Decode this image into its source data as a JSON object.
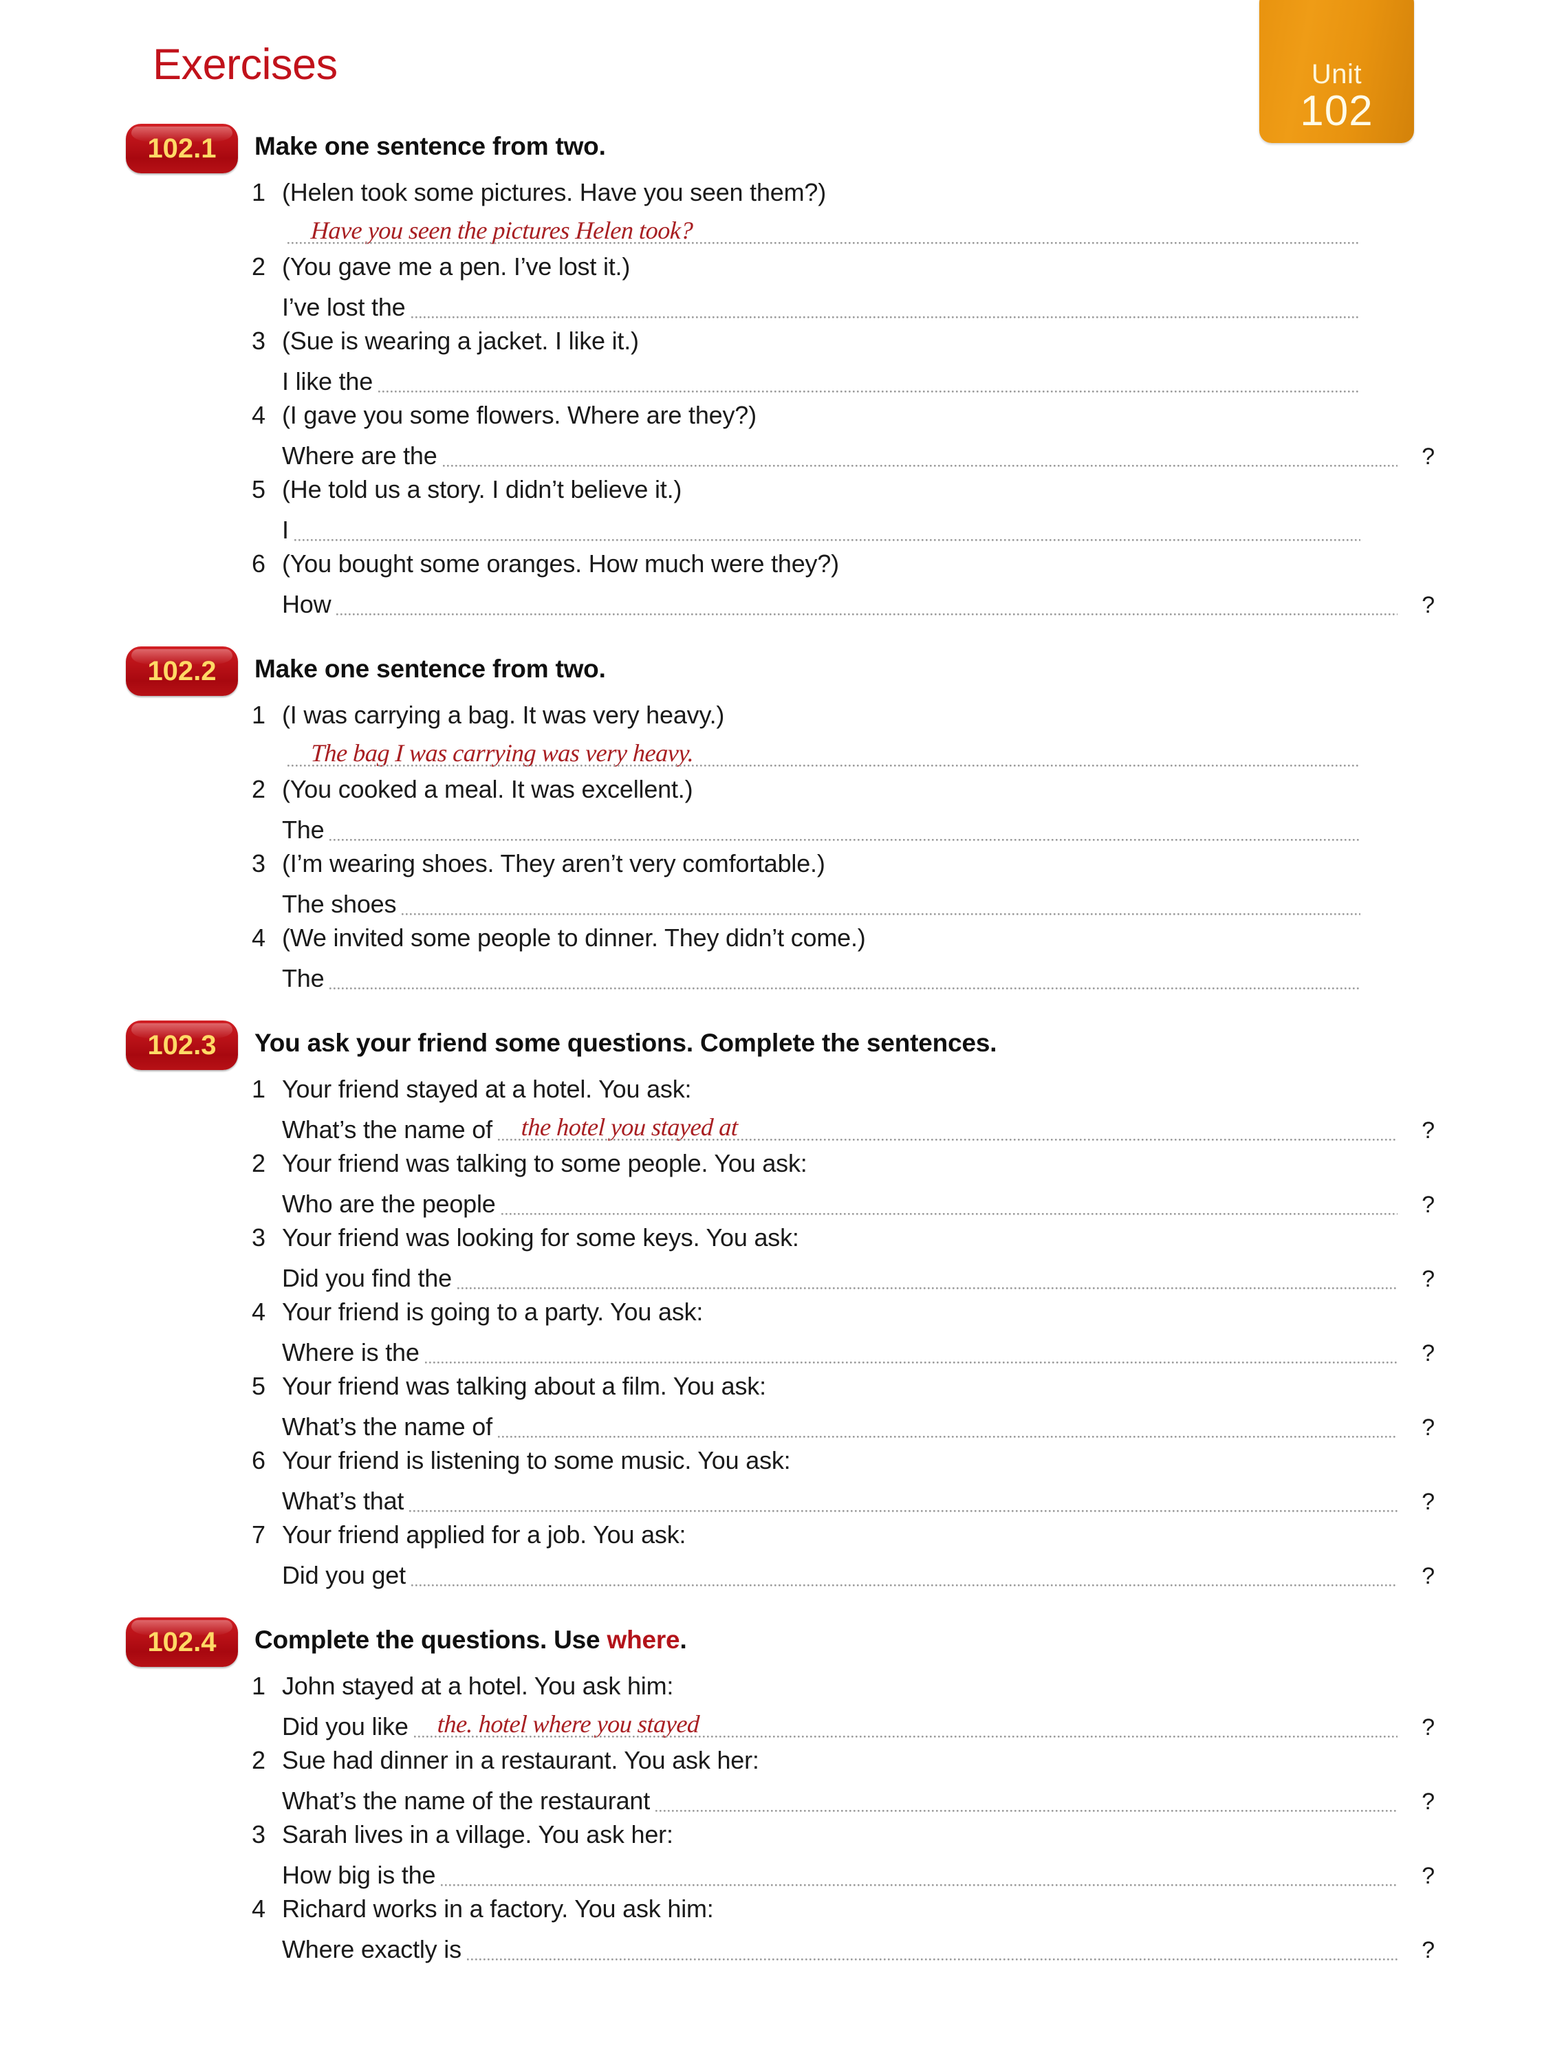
{
  "page": {
    "title": "Exercises",
    "title_color": "#c1121b",
    "unit_label": "Unit",
    "unit_number": "102",
    "badge_color": "#e8930f",
    "exercise_badge_color": "#c2161c",
    "handwriting_color": "#a81f22"
  },
  "exercises": [
    {
      "badge": "102.1",
      "title_pre": "Make one sentence from two.",
      "title_hl": "",
      "title_post": "",
      "items": [
        {
          "num": "1",
          "prompt": "(Helen took some pictures.  Have you seen them?)",
          "lead": "",
          "answer": "Have you seen the pictures Helen took?",
          "question_mark": ""
        },
        {
          "num": "2",
          "prompt": "(You gave me a pen.  I’ve lost it.)",
          "lead": "I’ve lost the",
          "answer": "",
          "question_mark": ""
        },
        {
          "num": "3",
          "prompt": "(Sue is wearing a jacket.  I like it.)",
          "lead": "I like the",
          "answer": "",
          "question_mark": ""
        },
        {
          "num": "4",
          "prompt": "(I gave you some flowers.  Where are they?)",
          "lead": "Where are the",
          "answer": "",
          "question_mark": "?"
        },
        {
          "num": "5",
          "prompt": "(He told us a story.  I didn’t believe it.)",
          "lead": "I",
          "answer": "",
          "question_mark": ""
        },
        {
          "num": "6",
          "prompt": "(You bought some oranges.  How much were they?)",
          "lead": "How",
          "answer": "",
          "question_mark": "?"
        }
      ]
    },
    {
      "badge": "102.2",
      "title_pre": "Make one sentence from two.",
      "title_hl": "",
      "title_post": "",
      "items": [
        {
          "num": "1",
          "prompt": "(I was carrying a bag.  It was very heavy.)",
          "lead": "",
          "answer": "The bag I was carrying was very heavy.",
          "question_mark": ""
        },
        {
          "num": "2",
          "prompt": "(You cooked a meal.  It was excellent.)",
          "lead": "The",
          "answer": "",
          "question_mark": ""
        },
        {
          "num": "3",
          "prompt": "(I’m wearing shoes.  They aren’t very comfortable.)",
          "lead": "The shoes",
          "answer": "",
          "question_mark": ""
        },
        {
          "num": "4",
          "prompt": "(We invited some people to dinner.  They didn’t come.)",
          "lead": "The",
          "answer": "",
          "question_mark": ""
        }
      ]
    },
    {
      "badge": "102.3",
      "title_pre": "You ask your friend some questions.  Complete the sentences.",
      "title_hl": "",
      "title_post": "",
      "items": [
        {
          "num": "1",
          "prompt": "Your friend stayed at a hotel.  You ask:",
          "lead": "What’s the name of",
          "answer": "the hotel you stayed at",
          "question_mark": "?"
        },
        {
          "num": "2",
          "prompt": "Your friend was talking to some people.  You ask:",
          "lead": "Who are the people",
          "answer": "",
          "question_mark": "?"
        },
        {
          "num": "3",
          "prompt": "Your friend was looking for some keys.  You ask:",
          "lead": "Did you find the",
          "answer": "",
          "question_mark": "?"
        },
        {
          "num": "4",
          "prompt": "Your friend is going to a party.  You ask:",
          "lead": "Where is the",
          "answer": "",
          "question_mark": "?"
        },
        {
          "num": "5",
          "prompt": "Your friend was talking about a film.  You ask:",
          "lead": "What’s the name of",
          "answer": "",
          "question_mark": "?"
        },
        {
          "num": "6",
          "prompt": "Your friend is listening to some music.  You ask:",
          "lead": "What’s that",
          "answer": "",
          "question_mark": "?"
        },
        {
          "num": "7",
          "prompt": "Your friend applied for a job. You ask:",
          "lead": "Did you get",
          "answer": "",
          "question_mark": "?"
        }
      ]
    },
    {
      "badge": "102.4",
      "title_pre": "Complete the questions.  Use ",
      "title_hl": "where",
      "title_post": ".",
      "items": [
        {
          "num": "1",
          "prompt": "John stayed at a hotel.  You ask him:",
          "lead": "Did you like",
          "answer": "the. hotel where you stayed",
          "question_mark": "?"
        },
        {
          "num": "2",
          "prompt": "Sue had dinner in a restaurant.  You ask her:",
          "lead": "What’s the name of the restaurant",
          "answer": "",
          "question_mark": "?"
        },
        {
          "num": "3",
          "prompt": "Sarah lives in a village.  You ask her:",
          "lead": "How big is the",
          "answer": "",
          "question_mark": "?"
        },
        {
          "num": "4",
          "prompt": "Richard works in a factory.  You ask him:",
          "lead": "Where exactly is",
          "answer": "",
          "question_mark": "?"
        }
      ]
    }
  ]
}
